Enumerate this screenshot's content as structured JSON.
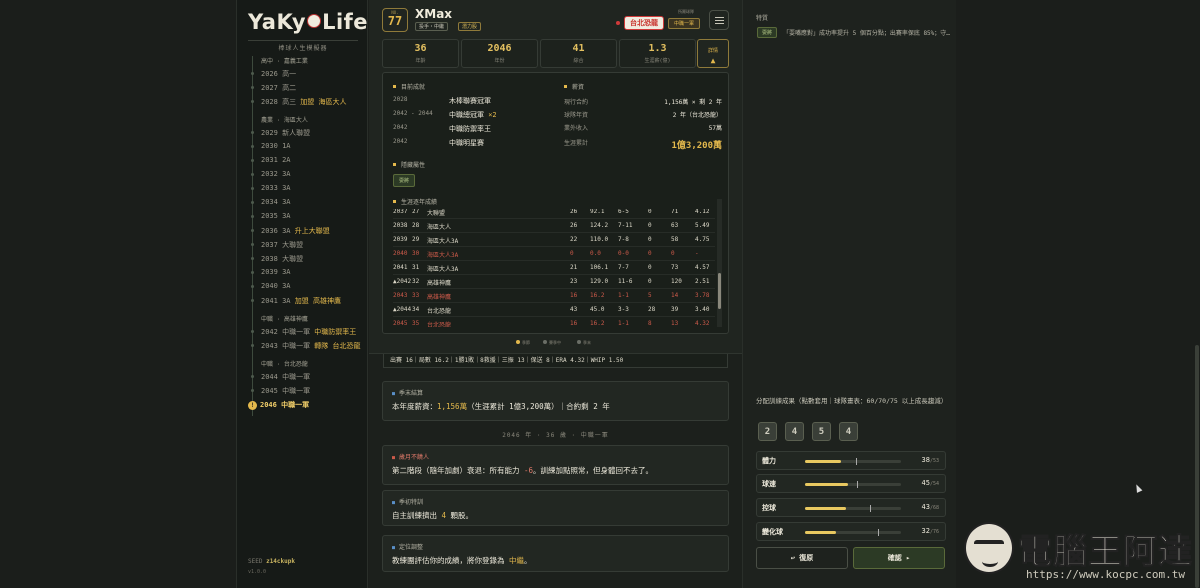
{
  "app": {
    "logo": "YaKyoLife",
    "logo_pre": "YaKy",
    "logo_post": "Life",
    "subtitle": "棒球人生模擬器",
    "seed_label": "SEED",
    "seed": "z14ckupk",
    "version": "v1.0.0"
  },
  "timeline": {
    "sections": [
      {
        "label": "高中 · 嘉義工業"
      },
      {
        "label": "農業 · 海區大人"
      },
      {
        "label": "中職 · 高雄神鷹"
      },
      {
        "label": "中職 · 台北恐龍"
      }
    ],
    "rows": [
      {
        "text": "2026 高一",
        "hl": ""
      },
      {
        "text": "2027 高二",
        "hl": ""
      },
      {
        "text": "2028 高三",
        "hl": "加盟 海區大人"
      },
      {
        "text": "2029 新人聯盟",
        "hl": ""
      },
      {
        "text": "2030 1A",
        "hl": ""
      },
      {
        "text": "2031 2A",
        "hl": ""
      },
      {
        "text": "2032 3A",
        "hl": ""
      },
      {
        "text": "2033 3A",
        "hl": ""
      },
      {
        "text": "2034 3A",
        "hl": ""
      },
      {
        "text": "2035 3A",
        "hl": ""
      },
      {
        "text": "2036 3A",
        "hl": "升上大聯盟"
      },
      {
        "text": "2037 大聯盟",
        "hl": ""
      },
      {
        "text": "2038 大聯盟",
        "hl": ""
      },
      {
        "text": "2039 3A",
        "hl": ""
      },
      {
        "text": "2040 3A",
        "hl": ""
      },
      {
        "text": "2041 3A",
        "hl": "加盟 高雄神鷹"
      },
      {
        "text": "2042 中職一軍",
        "hl": "中職防禦率王"
      },
      {
        "text": "2043 中職一軍",
        "hl": "轉隊 台北恐龍"
      },
      {
        "text": "2044 中職一軍",
        "hl": ""
      },
      {
        "text": "2045 中職一軍",
        "hl": ""
      }
    ],
    "current": "2046 中職一軍",
    "current_mark": "!"
  },
  "player": {
    "no_label": "NO.",
    "number": "77",
    "name": "XMax",
    "tags": [
      "投手・中繼",
      "潛力股"
    ],
    "team_label": "所屬球隊",
    "team": "台北恐龍",
    "level": "中職一軍",
    "stats": [
      {
        "value": "36",
        "label": "年齡"
      },
      {
        "value": "2046",
        "label": "年份"
      },
      {
        "value": "41",
        "label": "綜合"
      },
      {
        "value": "1.3",
        "label": "生涯薪(億)"
      }
    ],
    "detail_label": "詳情",
    "detail_icon": "▲"
  },
  "panel": {
    "ach_title": "目前成就",
    "achievements": [
      {
        "year": "2028",
        "text": "木棒聯賽冠軍",
        "mult": ""
      },
      {
        "year": "2042 - 2044",
        "text": "中職總冠軍",
        "mult": "×2"
      },
      {
        "year": "2042",
        "text": "中職防禦率王",
        "mult": ""
      },
      {
        "year": "2042",
        "text": "中職明星賽",
        "mult": ""
      }
    ],
    "salary_title": "薪資",
    "salary": [
      {
        "k": "現行合約",
        "v": "1,156萬 × 剩 2 年"
      },
      {
        "k": "球隊年資",
        "v": "2 年（台北恐龍）"
      },
      {
        "k": "業外收入",
        "v": "57萬"
      },
      {
        "k": "生涯累計",
        "v": "1億3,200萬"
      }
    ],
    "hidden_title": "隱藏屬性",
    "hidden_chip": "耍將",
    "career_title": "生涯逐年成績",
    "career_rows": [
      {
        "y": "2037",
        "a": "27",
        "team": "大聯盟",
        "g": "26",
        "ip": "92.1",
        "wl": "6-5",
        "sv": "0",
        "so": "71",
        "era": "4.12",
        "style": ""
      },
      {
        "y": "2038",
        "a": "28",
        "team": "海區大人",
        "g": "26",
        "ip": "124.2",
        "wl": "7-11",
        "sv": "0",
        "so": "63",
        "era": "5.49",
        "style": ""
      },
      {
        "y": "2039",
        "a": "29",
        "team": "海區大人3A",
        "g": "22",
        "ip": "110.0",
        "wl": "7-8",
        "sv": "0",
        "so": "58",
        "era": "4.75",
        "style": ""
      },
      {
        "y": "2040",
        "a": "30",
        "team": "海區大人3A",
        "g": "0",
        "ip": "0.0",
        "wl": "0-0",
        "sv": "0",
        "so": "0",
        "era": "-",
        "style": "red"
      },
      {
        "y": "2041",
        "a": "31",
        "team": "海區大人3A",
        "g": "21",
        "ip": "106.1",
        "wl": "7-7",
        "sv": "0",
        "so": "73",
        "era": "4.57",
        "style": ""
      },
      {
        "y": "▲2042",
        "a": "32",
        "team": "高雄神鷹",
        "g": "23",
        "ip": "129.0",
        "wl": "11-6",
        "sv": "0",
        "so": "120",
        "era": "2.51",
        "style": ""
      },
      {
        "y": "2043",
        "a": "33",
        "team": "高雄神鷹",
        "g": "16",
        "ip": "16.2",
        "wl": "1-1",
        "sv": "5",
        "so": "14",
        "era": "3.78",
        "style": "red"
      },
      {
        "y": "▲2044",
        "a": "34",
        "team": "台北恐龍",
        "g": "43",
        "ip": "45.0",
        "wl": "3-3",
        "sv": "28",
        "so": "39",
        "era": "3.40",
        "style": ""
      },
      {
        "y": "2045",
        "a": "35",
        "team": "台北恐龍",
        "g": "16",
        "ip": "16.2",
        "wl": "1-1",
        "sv": "8",
        "so": "13",
        "era": "4.32",
        "style": "red"
      }
    ]
  },
  "legend": [
    {
      "label": "季節",
      "color": "#e3b84c"
    },
    {
      "label": "賽季中",
      "color": "#6a6e66"
    },
    {
      "label": "季末",
      "color": "#6a6e66"
    }
  ],
  "season_line": "出賽 16｜局數 16.2｜1勝1敗｜8救援｜三振 13｜保送 8｜ERA 4.32｜WHIP 1.50",
  "cards": [
    {
      "title": "季末結算",
      "body_pre": "本年度薪資：",
      "body_hl": "1,156萬",
      "body_post": "（生涯累計 1億3,200萬）｜合約剩 2 年"
    },
    {
      "title": "歲月不饒人",
      "body_pre": "第二階段（隨年加劇）衰退：所有能力 ",
      "body_hl": "-6",
      "body_post": "。訓練加點照常，但身體回不去了。"
    },
    {
      "title": "季初特訓",
      "body_pre": "自主訓練擠出 ",
      "body_hl": "4",
      "body_post": " 顆股。"
    },
    {
      "title": "定位調整",
      "body_pre": "教練團評估你的成績，將你登錄為 ",
      "body_hl": "中繼",
      "body_post": "。"
    }
  ],
  "divider": "2046 年 · 36 歲 · 中職一軍",
  "right": {
    "title": "特質",
    "chip": "耍將",
    "desc": "「耍嘴應對」成功率提升 5 個百分點；出賽率保底 85%；守…",
    "train_title": "分配訓練成果（點數套用｜球隊畫表：60/70/75 以上成長趨減）",
    "points": [
      "2",
      "4",
      "5",
      "4"
    ],
    "bars": [
      {
        "label": "體力",
        "value": 38,
        "max": 53,
        "cap": 53
      },
      {
        "label": "球速",
        "value": 45,
        "max": 54,
        "cap": 54
      },
      {
        "label": "控球",
        "value": 43,
        "max": 68,
        "cap": 68
      },
      {
        "label": "變化球",
        "value": 32,
        "max": 76,
        "cap": 76
      }
    ],
    "undo": "↩ 復原",
    "confirm": "確認 ▸"
  },
  "watermark": {
    "text": "電腦王阿達",
    "url": "https://www.kocpc.com.tw"
  }
}
